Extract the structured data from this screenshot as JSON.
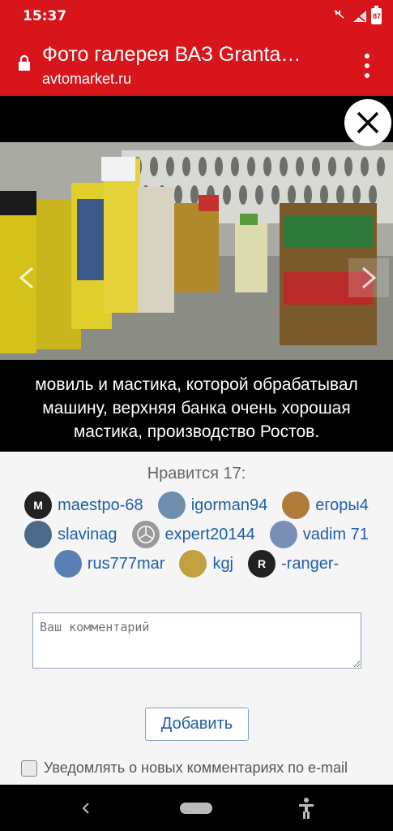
{
  "status_bar": {
    "time": "15:37",
    "battery": "87"
  },
  "toolbar": {
    "title": "Фото галерея ВАЗ Granta…",
    "domain": "avtomarket.ru"
  },
  "photo": {
    "caption": "мовиль и мастика, которой обрабатывал машину, верхняя банка очень хорошая мастика, производство Ростов."
  },
  "likes": {
    "title": "Нравится 17:",
    "users": [
      {
        "name": "maestpo-68",
        "avatar": "M",
        "avatar_color": "#222222"
      },
      {
        "name": "igorman94",
        "avatar": "",
        "avatar_color": "#6f8fb0"
      },
      {
        "name": "егоры4",
        "avatar": "",
        "avatar_color": "#b07a3a"
      },
      {
        "name": "slavinag",
        "avatar": "",
        "avatar_color": "#4b6a8a"
      },
      {
        "name": "expert20144",
        "avatar": "",
        "avatar_color": "#9a9a9a"
      },
      {
        "name": "vadim 71",
        "avatar": "",
        "avatar_color": "#7a8fb8"
      },
      {
        "name": "rus777mar",
        "avatar": "",
        "avatar_color": "#5a7fb5"
      },
      {
        "name": "kgj",
        "avatar": "",
        "avatar_color": "#c0a040"
      },
      {
        "name": "-ranger-",
        "avatar": "R",
        "avatar_color": "#222222"
      }
    ]
  },
  "comment": {
    "placeholder": "Ваш комментарий"
  },
  "actions": {
    "add_label": "Добавить",
    "notify_label": "Уведомлять о новых комментариях по e-mail"
  }
}
